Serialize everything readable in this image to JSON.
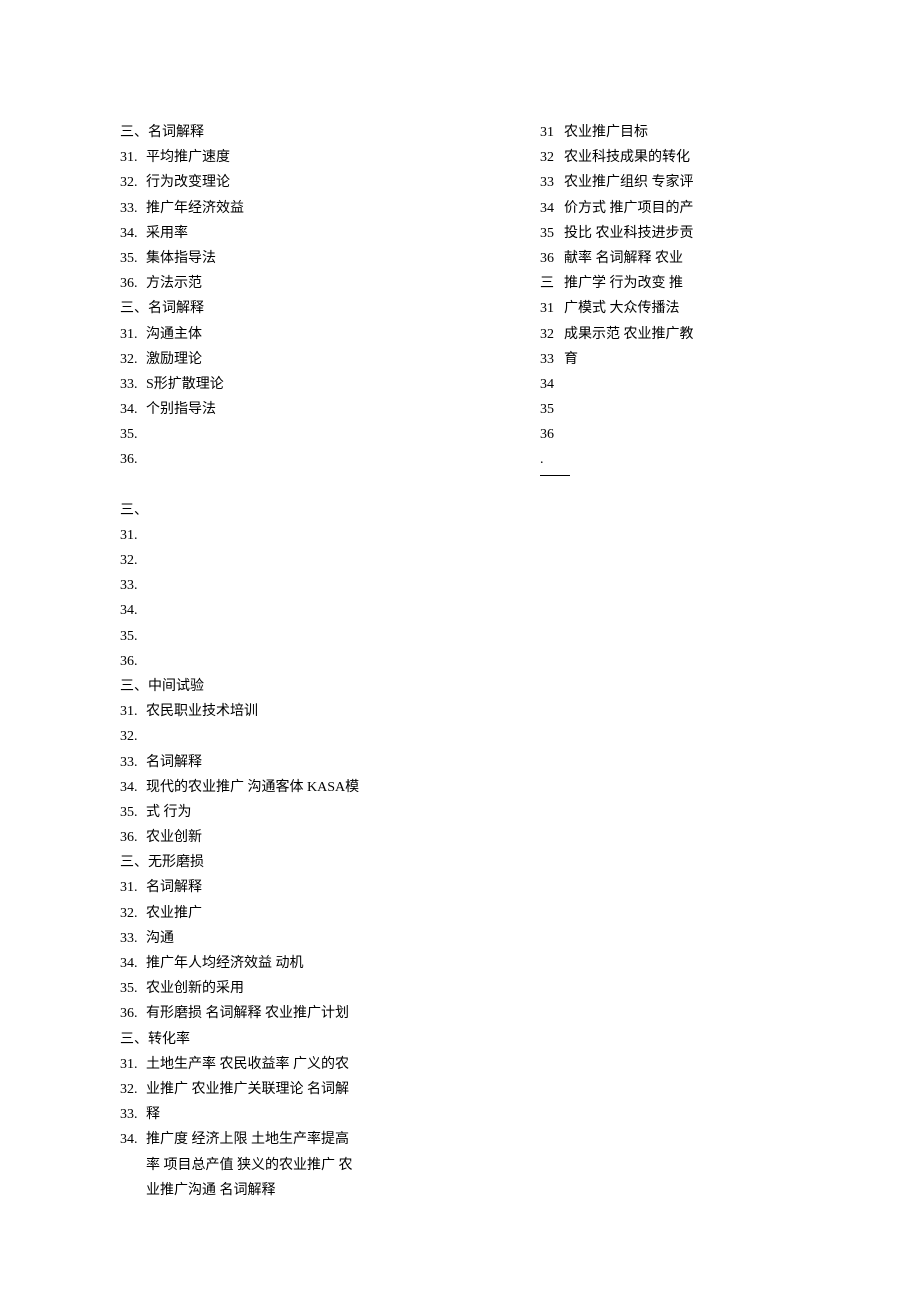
{
  "left_column": [
    {
      "label": "三、",
      "text": "名词解释"
    },
    {
      "label": "31.",
      "text": "平均推广速度"
    },
    {
      "label": "32.",
      "text": "行为改变理论"
    },
    {
      "label": "33.",
      "text": "推广年经济效益"
    },
    {
      "label": "34.",
      "text": "采用率"
    },
    {
      "label": "35.",
      "text": "集体指导法"
    },
    {
      "label": "36.",
      "text": "方法示范"
    },
    {
      "label": "三、",
      "text": "名词解释"
    },
    {
      "label": "31.",
      "text": "沟通主体"
    },
    {
      "label": "32.",
      "text": "激励理论"
    },
    {
      "label": "33.",
      "text": "S形扩散理论"
    },
    {
      "label": "34.",
      "text": "个别指导法"
    },
    {
      "label": "35.",
      "text": ""
    },
    {
      "label": "36.",
      "text": ""
    },
    {
      "label": "",
      "text": ""
    },
    {
      "label": "三、",
      "text": ""
    },
    {
      "label": "31.",
      "text": ""
    },
    {
      "label": "32.",
      "text": ""
    },
    {
      "label": "33.",
      "text": ""
    },
    {
      "label": "34.",
      "text": ""
    },
    {
      "label": "35.",
      "text": ""
    },
    {
      "label": "36.",
      "text": ""
    },
    {
      "label": "三、",
      "text": "中间试验"
    },
    {
      "label": "31.",
      "text": "农民职业技术培训"
    },
    {
      "label": "32.",
      "text": ""
    },
    {
      "label": "33.",
      "text": "名词解释"
    },
    {
      "label": "34.",
      "text": "现代的农业推广 沟通客体 KASA模"
    },
    {
      "label": "35.",
      "text": "式 行为"
    },
    {
      "label": "36.",
      "text": "农业创新"
    },
    {
      "label": "三、",
      "text": "无形磨损"
    },
    {
      "label": "31.",
      "text": "名词解释"
    },
    {
      "label": "32.",
      "text": "农业推广"
    },
    {
      "label": "33.",
      "text": "沟通"
    },
    {
      "label": "34.",
      "text": "推广年人均经济效益 动机"
    },
    {
      "label": "35.",
      "text": "农业创新的采用"
    },
    {
      "label": "36.",
      "text": "有形磨损 名词解释 农业推广计划"
    },
    {
      "label": "三、",
      "text": "转化率"
    },
    {
      "label": "31.",
      "text": "土地生产率 农民收益率 广义的农"
    },
    {
      "label": "32.",
      "text": "业推广 农业推广关联理论 名词解"
    },
    {
      "label": "33.",
      "text": "释"
    },
    {
      "label": "34.",
      "text": "推广度 经济上限 土地生产率提高"
    },
    {
      "label": "",
      "text": "率 项目总产值 狭义的农业推广 农"
    },
    {
      "label": "",
      "text": "业推广沟通 名词解释"
    }
  ],
  "right_column": [
    {
      "label": "31",
      "text": "农业推广目标"
    },
    {
      "label": "32",
      "text": "农业科技成果的转化"
    },
    {
      "label": "33",
      "text": "农业推广组织 专家评"
    },
    {
      "label": "34",
      "text": "价方式 推广项目的产"
    },
    {
      "label": "35",
      "text": "投比 农业科技进步贡"
    },
    {
      "label": "36",
      "text": "献率 名词解释 农业"
    },
    {
      "label": "三",
      "text": "推广学 行为改变 推"
    },
    {
      "label": "31",
      "text": "广模式 大众传播法"
    },
    {
      "label": "32",
      "text": "成果示范 农业推广教"
    },
    {
      "label": "33",
      "text": "育"
    },
    {
      "label": "34",
      "text": ""
    },
    {
      "label": "35",
      "text": ""
    },
    {
      "label": "36",
      "text": ""
    },
    {
      "label": ".",
      "text": ""
    }
  ]
}
